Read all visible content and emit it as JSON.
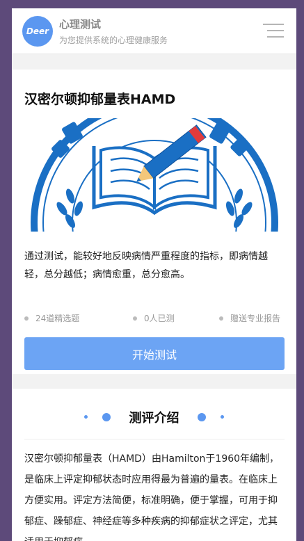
{
  "header": {
    "logo_text": "Deer",
    "title": "心理测试",
    "subtitle": "为您提供系统的心理健康服务"
  },
  "test": {
    "title": "汉密尔顿抑郁量表HAMD",
    "description": "通过测试，能较好地反映病情严重程度的指标，即病情越轻，总分越低；病情愈重，总分愈高。",
    "stats": [
      "24道精选题",
      "0人已测",
      "赠送专业报告"
    ],
    "start_label": "开始测试"
  },
  "section": {
    "title": "测评介绍",
    "intro": "汉密尔顿抑郁量表（HAMD）由Hamilton于1960年编制，是临床上评定抑郁状态时应用得最为普遍的量表。在临床上方便实用。评定方法简便，标准明确，便于掌握，可用于抑郁症、躁郁症、神经症等多种疾病的抑郁症状之评定，尤其适用于抑郁症。"
  },
  "colors": {
    "accent": "#6ca4f4",
    "logo": "#5b97f0",
    "banner_blue": "#1a6fc4",
    "pencil_red": "#e23b3b",
    "pencil_tip": "#f3c77a"
  },
  "icons": {
    "menu": "menu-icon",
    "banner": "book-pencil-illustration"
  }
}
